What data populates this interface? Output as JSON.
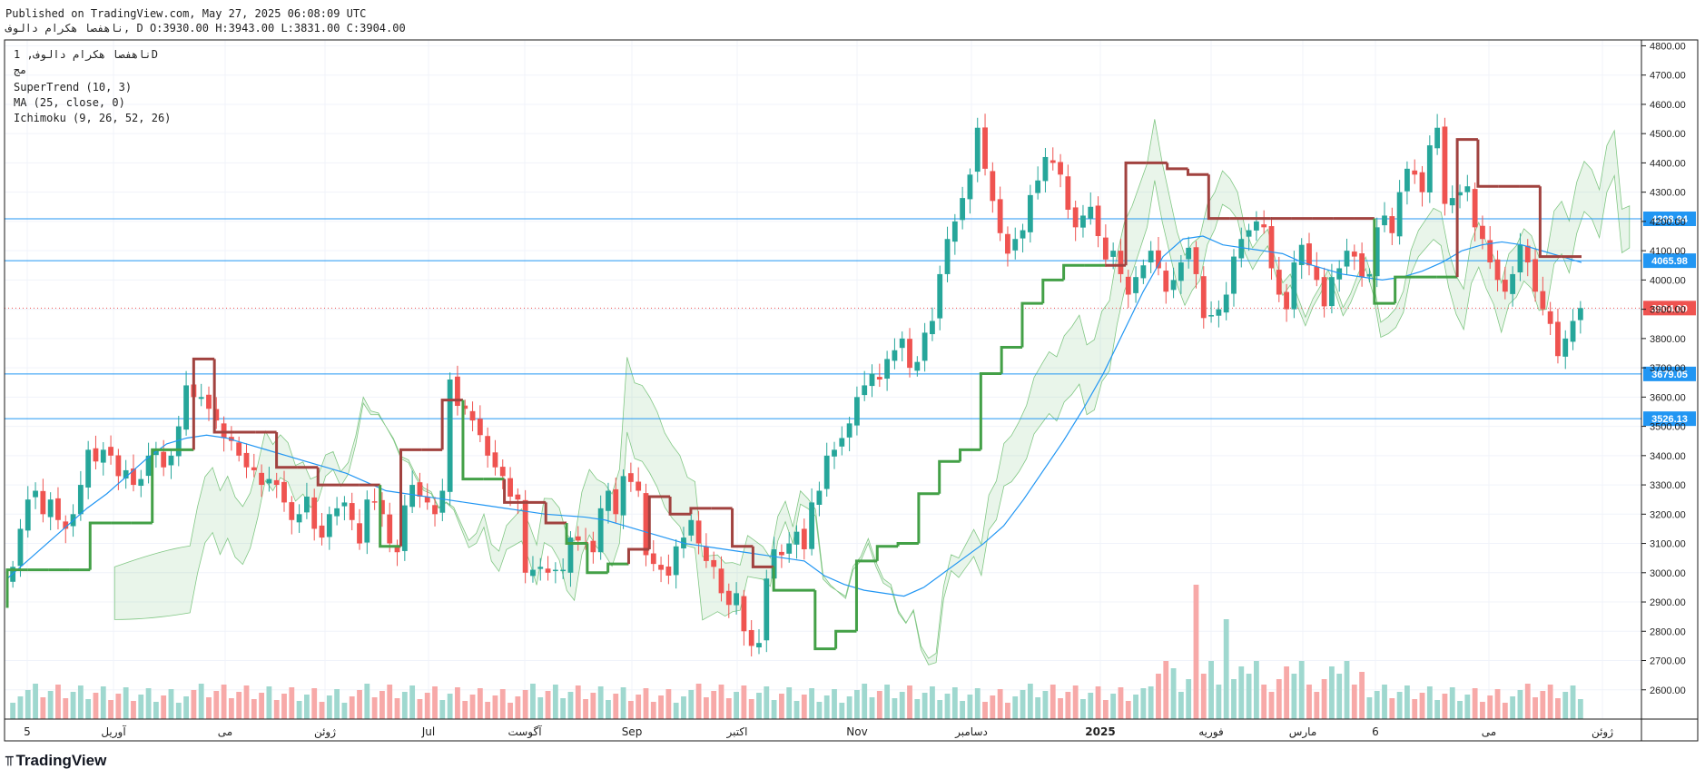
{
  "header": {
    "published": "Published on TradingView.com, May 27, 2025 06:08:09 UTC",
    "ohlc": "ناهفصا هکرام دالوف, D O:3930.00 H:3943.00 L:3831.00 C:3904.00"
  },
  "legend": {
    "symbol": "ناهفصا هکرام دالوف, 1D",
    "subtitle": "مج",
    "indicators": [
      "SuperTrend (10, 3)",
      "MA (25, close, 0)",
      "Ichimoku (9, 26, 52, 26)"
    ]
  },
  "brand": {
    "name": "TradingView",
    "logo": "tv-logo-icon"
  },
  "chart_data": {
    "type": "candlestick",
    "interval": "1D",
    "ylim": [
      2500,
      4820
    ],
    "y_ticks": [
      2600,
      2700,
      2800,
      2900,
      3000,
      3100,
      3200,
      3300,
      3400,
      3500,
      3600,
      3700,
      3800,
      3900,
      4000,
      4100,
      4200,
      4300,
      4400,
      4500,
      4600,
      4700,
      4800
    ],
    "x_ticks": [
      "5",
      "آوریل",
      "می",
      "ژوئن",
      "Jul",
      "آگوست",
      "Sep",
      "اکتبر",
      "Nov",
      "دسامبر",
      "2025",
      "فوریه",
      "مارس",
      "6",
      "می",
      "ژوئن"
    ],
    "horizontal_lines": [
      {
        "value": 4208.94,
        "label": "4208.94",
        "color": "#2196f3"
      },
      {
        "value": 4065.98,
        "label": "4065.98",
        "color": "#2196f3"
      },
      {
        "value": 3679.05,
        "label": "3679.05",
        "color": "#2196f3"
      },
      {
        "value": 3526.13,
        "label": "3526.13",
        "color": "#2196f3"
      }
    ],
    "last_price": {
      "value": 3904.0,
      "label": "3904.00",
      "color": "#ef5350"
    },
    "close_series": [
      3020,
      3150,
      3250,
      3280,
      3200,
      3250,
      3180,
      3150,
      3200,
      3300,
      3420,
      3380,
      3420,
      3400,
      3330,
      3350,
      3300,
      3320,
      3400,
      3420,
      3360,
      3400,
      3500,
      3640,
      3600,
      3600,
      3560,
      3520,
      3460,
      3450,
      3400,
      3360,
      3350,
      3300,
      3320,
      3300,
      3240,
      3180,
      3200,
      3260,
      3150,
      3120,
      3200,
      3220,
      3240,
      3180,
      3100,
      3250,
      3240,
      3200,
      3100,
      3070,
      3230,
      3300,
      3260,
      3240,
      3200,
      3280,
      3660,
      3570,
      3560,
      3520,
      3470,
      3400,
      3360,
      3330,
      3260,
      3250,
      3000,
      3010,
      3020,
      3000,
      3010,
      3010,
      3120,
      3110,
      3100,
      3070,
      3220,
      3280,
      3200,
      3330,
      3310,
      3280,
      3060,
      3030,
      3010,
      2990,
      3090,
      3120,
      3180,
      3100,
      3040,
      3020,
      2930,
      2890,
      2930,
      2800,
      2750,
      2760,
      2980,
      3080,
      3060,
      3100,
      3140,
      3080,
      3240,
      3280,
      3400,
      3420,
      3460,
      3510,
      3600,
      3640,
      3680,
      3660,
      3730,
      3760,
      3800,
      3700,
      3720,
      3820,
      3860,
      4020,
      4140,
      4200,
      4280,
      4360,
      4520,
      4380,
      4270,
      4160,
      4090,
      4140,
      4170,
      4290,
      4340,
      4420,
      4400,
      4360,
      4240,
      4180,
      4220,
      4250,
      4150,
      4070,
      4100,
      4020,
      3950,
      4010,
      4050,
      4100,
      4040,
      3960,
      4000,
      4060,
      4110,
      4020,
      3870,
      3880,
      3900,
      3950,
      4080,
      4140,
      4170,
      4200,
      4180,
      4040,
      3950,
      3900,
      4060,
      4120,
      4050,
      4000,
      3910,
      4010,
      4040,
      4100,
      4080,
      4010,
      4020,
      4180,
      4220,
      4160,
      4300,
      4380,
      4360,
      4300,
      4460,
      4520,
      4260,
      4280,
      4300,
      4320,
      4180,
      4140,
      4060,
      4000,
      3960,
      4020,
      4120,
      4060,
      3960,
      3900,
      3850,
      3740,
      3800,
      3860,
      3904
    ],
    "ma_25": [
      2980,
      3040,
      3100,
      3160,
      3220,
      3270,
      3330,
      3390,
      3440,
      3460,
      3470,
      3460,
      3440,
      3420,
      3400,
      3380,
      3360,
      3340,
      3310,
      3280,
      3270,
      3260,
      3250,
      3240,
      3230,
      3220,
      3210,
      3200,
      3195,
      3190,
      3180,
      3160,
      3140,
      3120,
      3100,
      3090,
      3080,
      3070,
      3060,
      3050,
      3040,
      2990,
      2960,
      2940,
      2930,
      2920,
      2950,
      3000,
      3050,
      3100,
      3160,
      3250,
      3350,
      3450,
      3560,
      3680,
      3820,
      3960,
      4080,
      4140,
      4150,
      4120,
      4110,
      4100,
      4090,
      4060,
      4040,
      4020,
      4010,
      4000,
      4010,
      4030,
      4060,
      4100,
      4120,
      4130,
      4120,
      4100,
      4080,
      4060
    ],
    "supertrend": [
      2880,
      3010,
      3010,
      3010,
      3010,
      3170,
      3170,
      3170,
      3420,
      3420,
      3730,
      3480,
      3480,
      3480,
      3360,
      3360,
      3300,
      3300,
      3300,
      3090,
      3420,
      3420,
      3590,
      3320,
      3320,
      3240,
      3240,
      3170,
      3100,
      3000,
      3030,
      3080,
      3260,
      3200,
      3220,
      3220,
      3090,
      3020,
      2940,
      2940,
      2740,
      2800,
      3040,
      3090,
      3100,
      3270,
      3380,
      3420,
      3680,
      3770,
      3920,
      4000,
      4050,
      4050,
      4050,
      4400,
      4400,
      4380,
      4360,
      4210,
      4210,
      4210,
      4210,
      4210,
      4210,
      4210,
      4210,
      3920,
      4010,
      4010,
      4010,
      4480,
      4320,
      4320,
      4320,
      4080,
      4080
    ],
    "ichimoku": {
      "leading_span_a_hi": 4260,
      "leading_span_b_lo": 2880,
      "cloud_colors": {
        "bull": "#4caf50",
        "bear": "#ef5350"
      }
    },
    "volume_note": "volume histogram at bottom of pane",
    "colors": {
      "up": "#26a69a",
      "down": "#ef5350",
      "ma": "#2196f3",
      "st_up": "#43a047",
      "st_down": "#a1423f"
    }
  }
}
